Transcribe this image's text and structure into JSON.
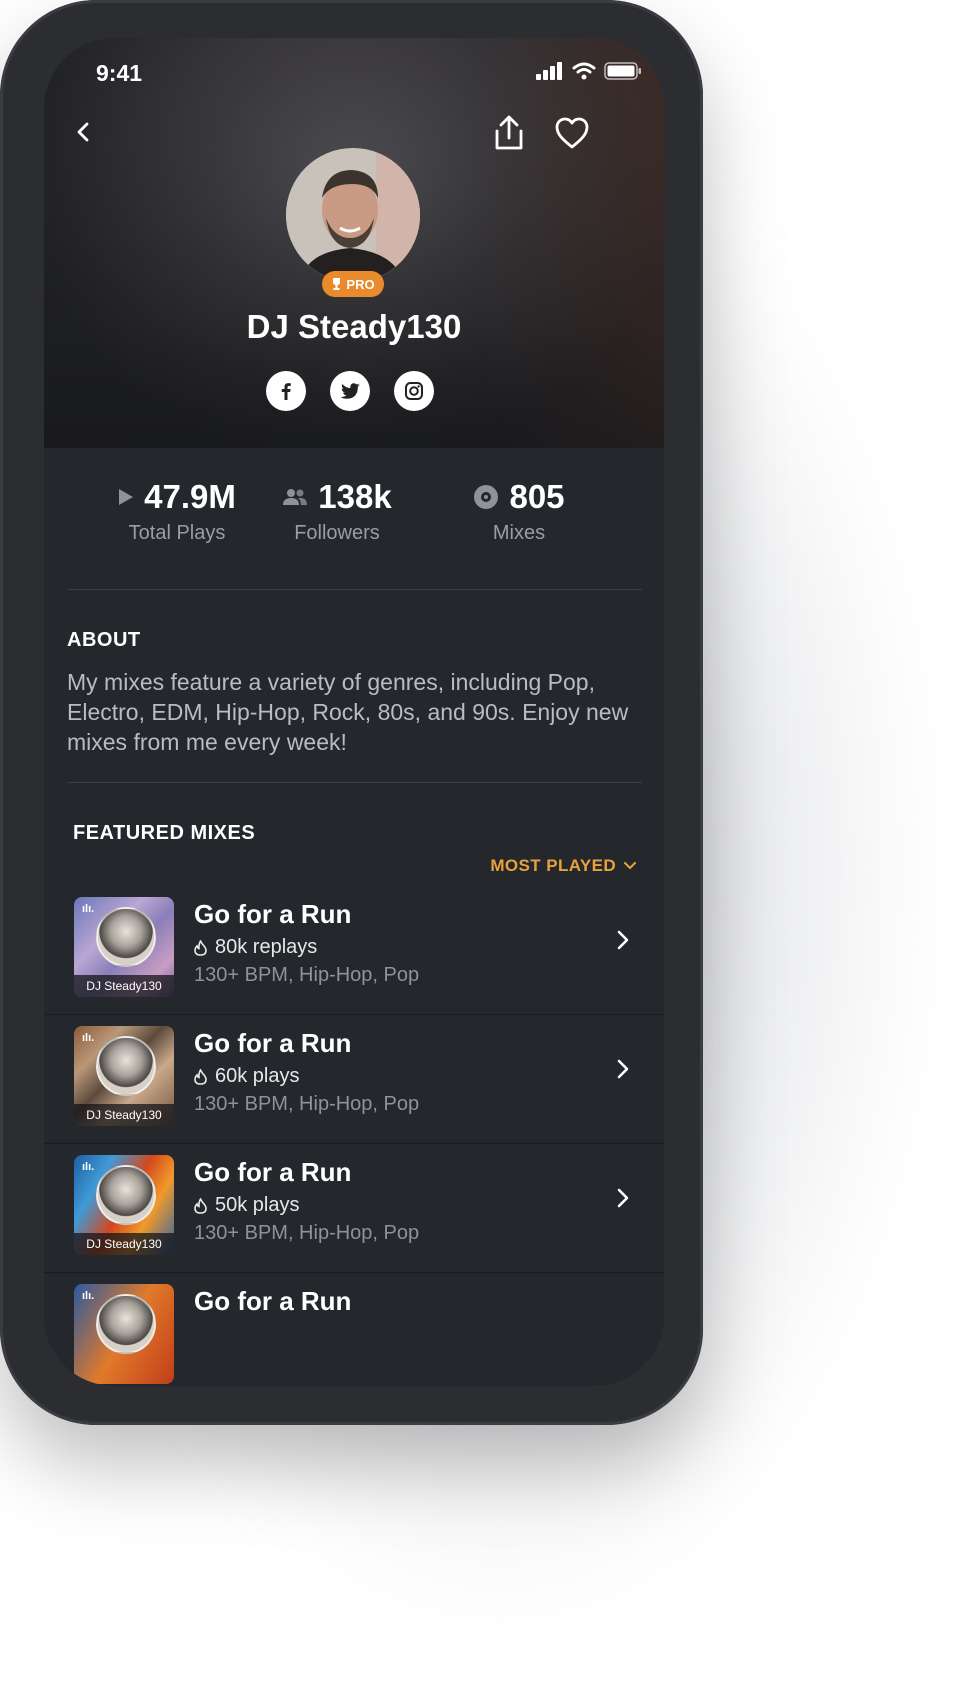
{
  "status": {
    "time": "9:41"
  },
  "profile": {
    "name": "DJ Steady130",
    "badge": "PRO"
  },
  "socials": [
    {
      "icon": "facebook-icon",
      "label": "f"
    },
    {
      "icon": "twitter-icon"
    },
    {
      "icon": "instagram-icon"
    }
  ],
  "stats": [
    {
      "value": "47.9M",
      "label": "Total Plays",
      "icon": "play-icon"
    },
    {
      "value": "138k",
      "label": "Followers",
      "icon": "users-icon"
    },
    {
      "value": "805",
      "label": "Mixes",
      "icon": "disc-icon"
    }
  ],
  "about": {
    "title": "ABOUT",
    "text": "My mixes feature a variety of genres, including Pop, Electro, EDM, Hip-Hop, Rock, 80s, and 90s. Enjoy new mixes from me every week!"
  },
  "featured": {
    "title": "FEATURED MIXES",
    "sort_label": "MOST PLAYED",
    "mixes": [
      {
        "title": "Go for a Run",
        "stat": "80k replays",
        "meta": "130+ BPM, Hip-Hop, Pop",
        "caption": "DJ Steady130"
      },
      {
        "title": "Go for a Run",
        "stat": "60k plays",
        "meta": "130+ BPM, Hip-Hop, Pop",
        "caption": "DJ Steady130"
      },
      {
        "title": "Go for a Run",
        "stat": "50k plays",
        "meta": "130+ BPM, Hip-Hop, Pop",
        "caption": "DJ Steady130"
      },
      {
        "title": "Go for a Run"
      }
    ]
  },
  "colors": {
    "accent": "#e9a23b",
    "badge": "#e98b2c",
    "background": "#24272b"
  }
}
